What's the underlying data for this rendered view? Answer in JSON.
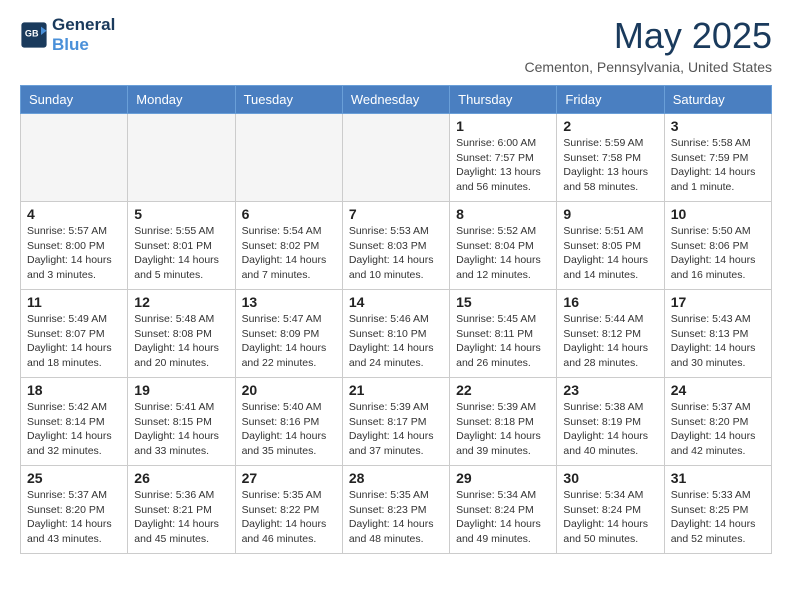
{
  "header": {
    "logo_line1": "General",
    "logo_line2": "Blue",
    "month_title": "May 2025",
    "location": "Cementon, Pennsylvania, United States"
  },
  "weekdays": [
    "Sunday",
    "Monday",
    "Tuesday",
    "Wednesday",
    "Thursday",
    "Friday",
    "Saturday"
  ],
  "weeks": [
    [
      {
        "day": "",
        "info": "",
        "empty": true
      },
      {
        "day": "",
        "info": "",
        "empty": true
      },
      {
        "day": "",
        "info": "",
        "empty": true
      },
      {
        "day": "",
        "info": "",
        "empty": true
      },
      {
        "day": "1",
        "info": "Sunrise: 6:00 AM\nSunset: 7:57 PM\nDaylight: 13 hours\nand 56 minutes."
      },
      {
        "day": "2",
        "info": "Sunrise: 5:59 AM\nSunset: 7:58 PM\nDaylight: 13 hours\nand 58 minutes."
      },
      {
        "day": "3",
        "info": "Sunrise: 5:58 AM\nSunset: 7:59 PM\nDaylight: 14 hours\nand 1 minute."
      }
    ],
    [
      {
        "day": "4",
        "info": "Sunrise: 5:57 AM\nSunset: 8:00 PM\nDaylight: 14 hours\nand 3 minutes."
      },
      {
        "day": "5",
        "info": "Sunrise: 5:55 AM\nSunset: 8:01 PM\nDaylight: 14 hours\nand 5 minutes."
      },
      {
        "day": "6",
        "info": "Sunrise: 5:54 AM\nSunset: 8:02 PM\nDaylight: 14 hours\nand 7 minutes."
      },
      {
        "day": "7",
        "info": "Sunrise: 5:53 AM\nSunset: 8:03 PM\nDaylight: 14 hours\nand 10 minutes."
      },
      {
        "day": "8",
        "info": "Sunrise: 5:52 AM\nSunset: 8:04 PM\nDaylight: 14 hours\nand 12 minutes."
      },
      {
        "day": "9",
        "info": "Sunrise: 5:51 AM\nSunset: 8:05 PM\nDaylight: 14 hours\nand 14 minutes."
      },
      {
        "day": "10",
        "info": "Sunrise: 5:50 AM\nSunset: 8:06 PM\nDaylight: 14 hours\nand 16 minutes."
      }
    ],
    [
      {
        "day": "11",
        "info": "Sunrise: 5:49 AM\nSunset: 8:07 PM\nDaylight: 14 hours\nand 18 minutes."
      },
      {
        "day": "12",
        "info": "Sunrise: 5:48 AM\nSunset: 8:08 PM\nDaylight: 14 hours\nand 20 minutes."
      },
      {
        "day": "13",
        "info": "Sunrise: 5:47 AM\nSunset: 8:09 PM\nDaylight: 14 hours\nand 22 minutes."
      },
      {
        "day": "14",
        "info": "Sunrise: 5:46 AM\nSunset: 8:10 PM\nDaylight: 14 hours\nand 24 minutes."
      },
      {
        "day": "15",
        "info": "Sunrise: 5:45 AM\nSunset: 8:11 PM\nDaylight: 14 hours\nand 26 minutes."
      },
      {
        "day": "16",
        "info": "Sunrise: 5:44 AM\nSunset: 8:12 PM\nDaylight: 14 hours\nand 28 minutes."
      },
      {
        "day": "17",
        "info": "Sunrise: 5:43 AM\nSunset: 8:13 PM\nDaylight: 14 hours\nand 30 minutes."
      }
    ],
    [
      {
        "day": "18",
        "info": "Sunrise: 5:42 AM\nSunset: 8:14 PM\nDaylight: 14 hours\nand 32 minutes."
      },
      {
        "day": "19",
        "info": "Sunrise: 5:41 AM\nSunset: 8:15 PM\nDaylight: 14 hours\nand 33 minutes."
      },
      {
        "day": "20",
        "info": "Sunrise: 5:40 AM\nSunset: 8:16 PM\nDaylight: 14 hours\nand 35 minutes."
      },
      {
        "day": "21",
        "info": "Sunrise: 5:39 AM\nSunset: 8:17 PM\nDaylight: 14 hours\nand 37 minutes."
      },
      {
        "day": "22",
        "info": "Sunrise: 5:39 AM\nSunset: 8:18 PM\nDaylight: 14 hours\nand 39 minutes."
      },
      {
        "day": "23",
        "info": "Sunrise: 5:38 AM\nSunset: 8:19 PM\nDaylight: 14 hours\nand 40 minutes."
      },
      {
        "day": "24",
        "info": "Sunrise: 5:37 AM\nSunset: 8:20 PM\nDaylight: 14 hours\nand 42 minutes."
      }
    ],
    [
      {
        "day": "25",
        "info": "Sunrise: 5:37 AM\nSunset: 8:20 PM\nDaylight: 14 hours\nand 43 minutes."
      },
      {
        "day": "26",
        "info": "Sunrise: 5:36 AM\nSunset: 8:21 PM\nDaylight: 14 hours\nand 45 minutes."
      },
      {
        "day": "27",
        "info": "Sunrise: 5:35 AM\nSunset: 8:22 PM\nDaylight: 14 hours\nand 46 minutes."
      },
      {
        "day": "28",
        "info": "Sunrise: 5:35 AM\nSunset: 8:23 PM\nDaylight: 14 hours\nand 48 minutes."
      },
      {
        "day": "29",
        "info": "Sunrise: 5:34 AM\nSunset: 8:24 PM\nDaylight: 14 hours\nand 49 minutes."
      },
      {
        "day": "30",
        "info": "Sunrise: 5:34 AM\nSunset: 8:24 PM\nDaylight: 14 hours\nand 50 minutes."
      },
      {
        "day": "31",
        "info": "Sunrise: 5:33 AM\nSunset: 8:25 PM\nDaylight: 14 hours\nand 52 minutes."
      }
    ]
  ]
}
